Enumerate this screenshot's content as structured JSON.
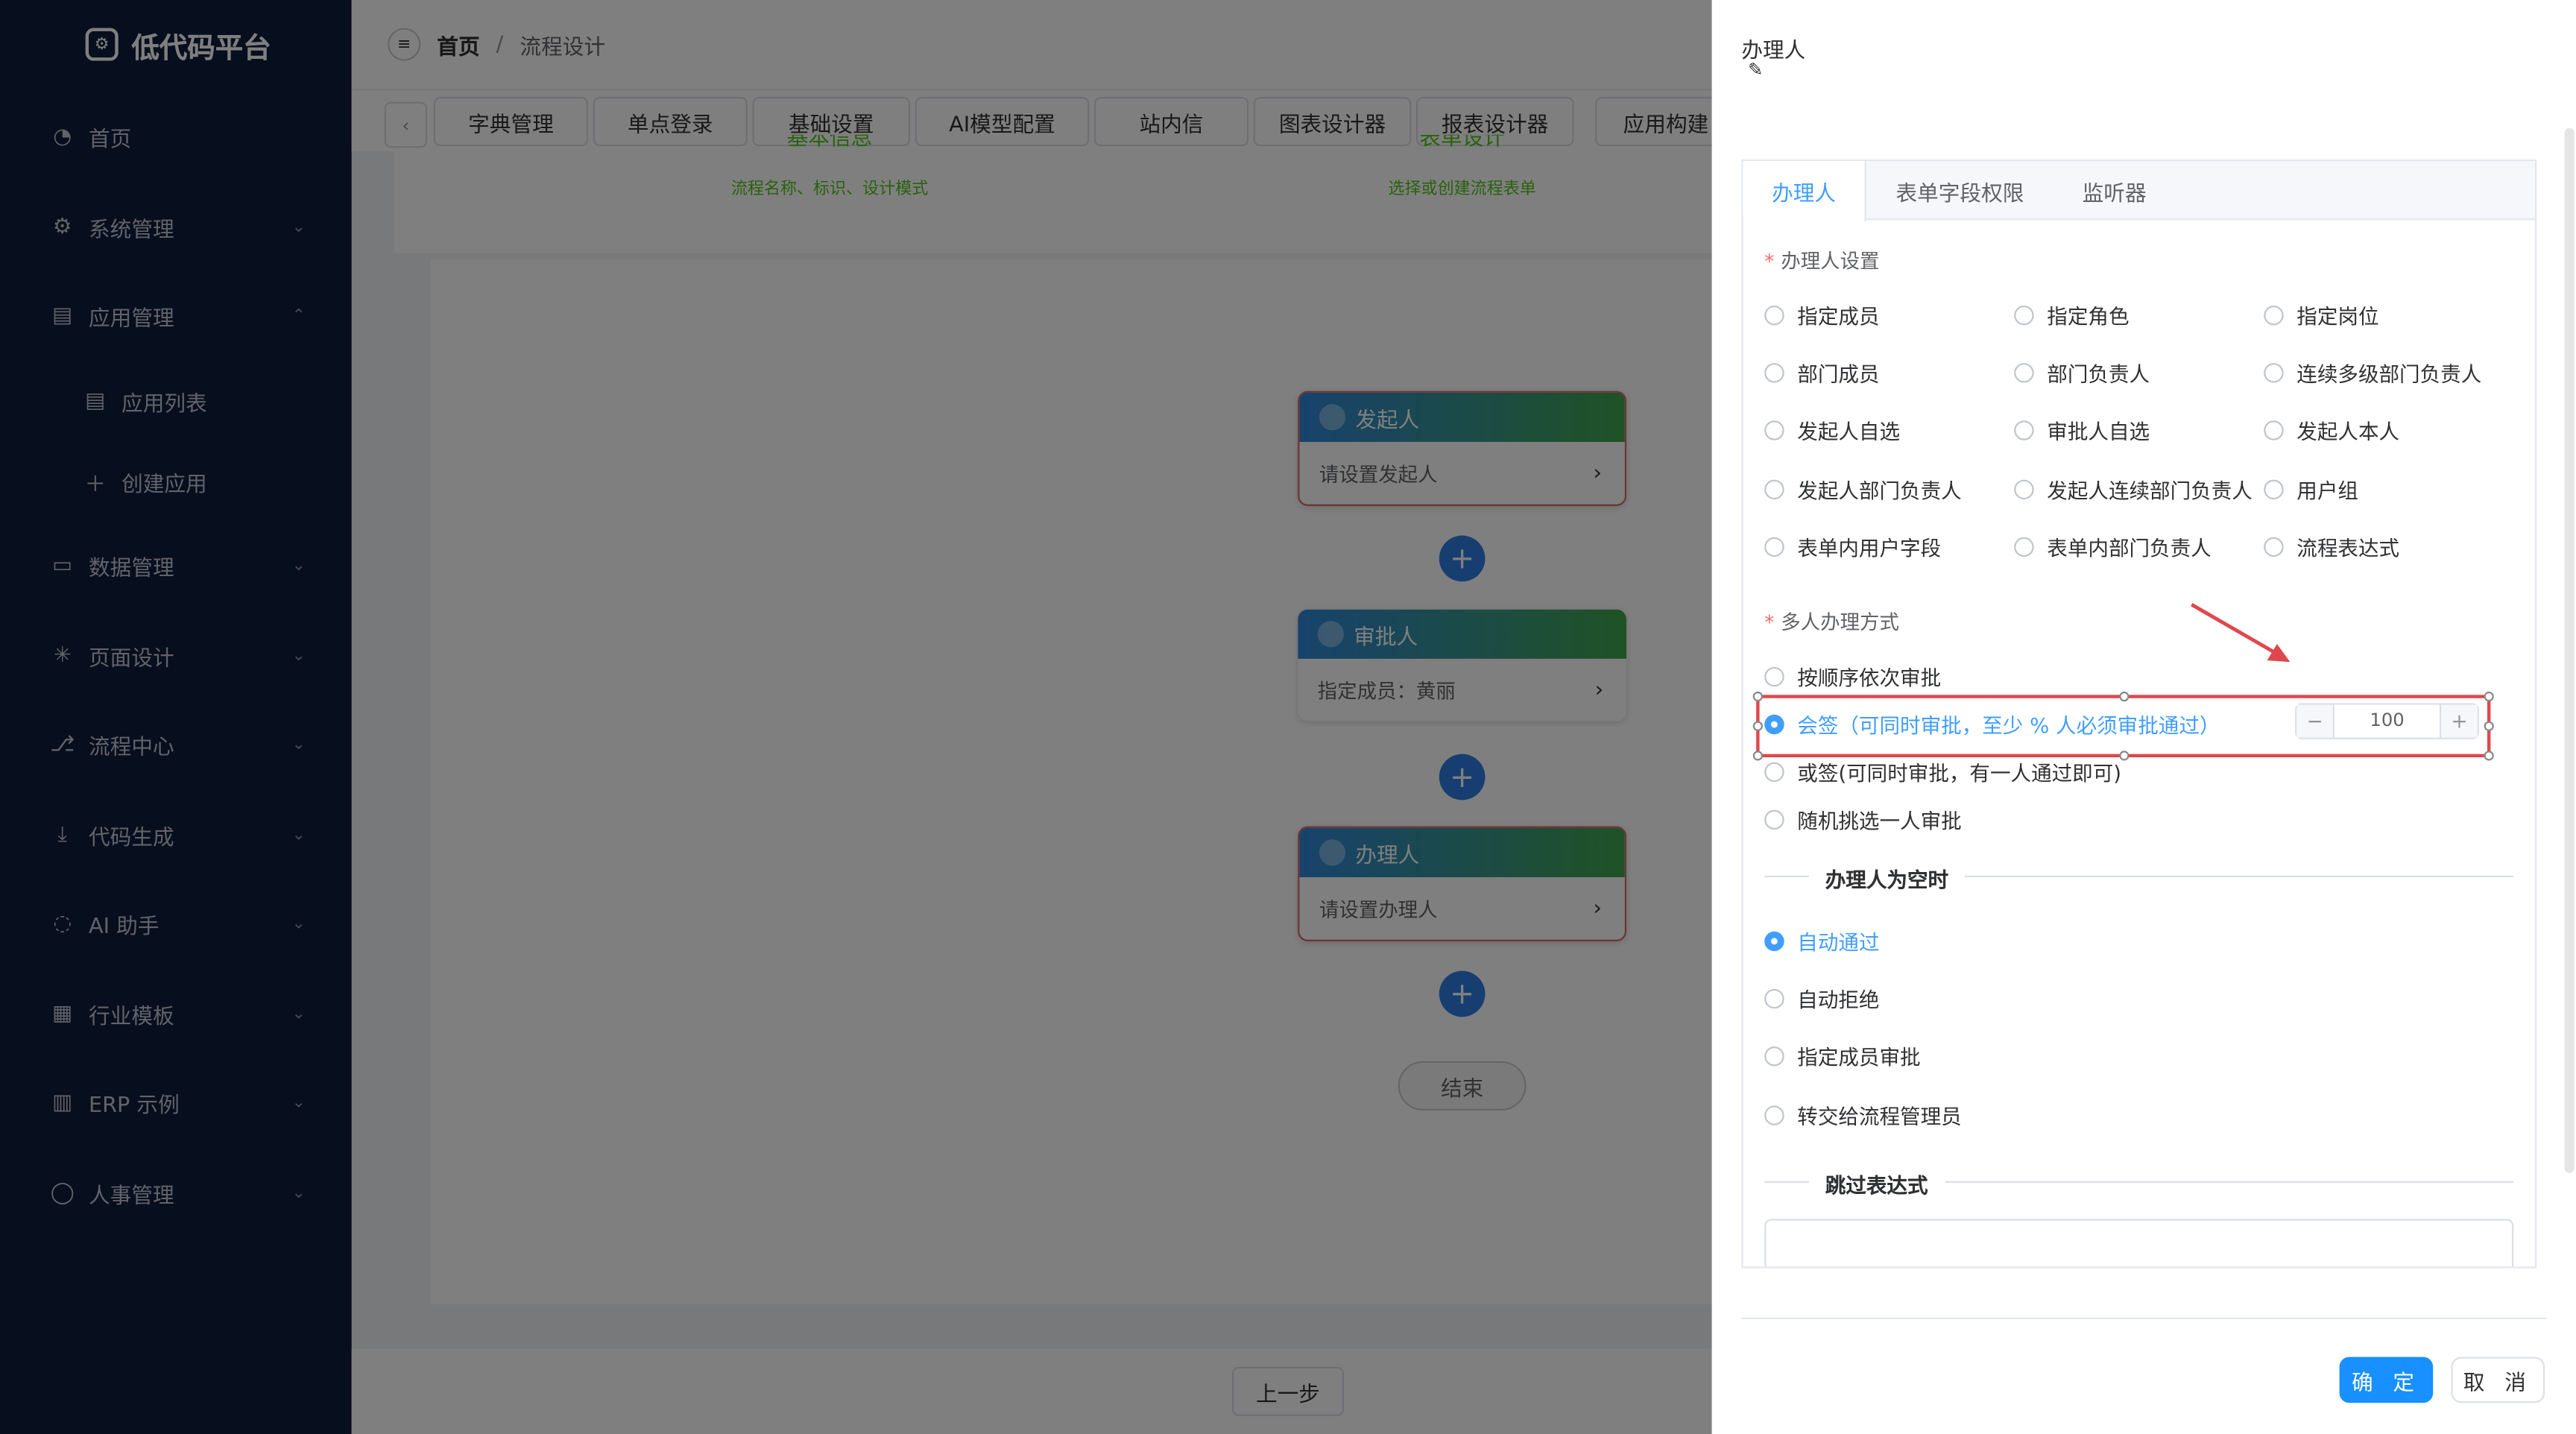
{
  "app": {
    "title": "低代码平台"
  },
  "sidebar": {
    "items": [
      {
        "label": "首页",
        "icon": "dashboard-icon"
      },
      {
        "label": "系统管理",
        "icon": "gear-icon"
      },
      {
        "label": "应用管理",
        "icon": "document-icon"
      },
      {
        "label": "应用列表",
        "icon": "document-icon"
      },
      {
        "label": "创建应用",
        "icon": "plus-icon"
      },
      {
        "label": "数据管理",
        "icon": "chart-board-icon"
      },
      {
        "label": "页面设计",
        "icon": "sparkle-icon"
      },
      {
        "label": "流程中心",
        "icon": "flow-icon"
      },
      {
        "label": "代码生成",
        "icon": "download-icon"
      },
      {
        "label": "AI 助手",
        "icon": "chat-icon"
      },
      {
        "label": "行业模板",
        "icon": "grid-icon"
      },
      {
        "label": "ERP 示例",
        "icon": "building-icon"
      },
      {
        "label": "人事管理",
        "icon": "user-icon"
      }
    ]
  },
  "breadcrumb": {
    "home": "首页",
    "separator": "/",
    "current": "流程设计"
  },
  "tabs": [
    "字典管理",
    "单点登录",
    "基础设置",
    "AI模型配置",
    "站内信",
    "图表设计器",
    "报表设计器",
    "应用构建"
  ],
  "steps": [
    {
      "title": "基本信息",
      "desc": "流程名称、标识、设计模式"
    },
    {
      "title": "表单设计",
      "desc": "选择或创建流程表单"
    }
  ],
  "flow": {
    "nodes": [
      {
        "title": "发起人",
        "body": "请设置发起人"
      },
      {
        "title": "审批人",
        "body": "指定成员：黄丽"
      },
      {
        "title": "办理人",
        "body": "请设置办理人"
      }
    ],
    "end_label": "结束"
  },
  "footer": {
    "prev_label": "上一步"
  },
  "drawer": {
    "title": "办理人",
    "tabs": [
      "办理人",
      "表单字段权限",
      "监听器"
    ],
    "handler_section": {
      "label": "办理人设置",
      "options": [
        "指定成员",
        "指定角色",
        "指定岗位",
        "部门成员",
        "部门负责人",
        "连续多级部门负责人",
        "发起人自选",
        "审批人自选",
        "发起人本人",
        "发起人部门负责人",
        "发起人连续部门负责人",
        "用户组",
        "表单内用户字段",
        "表单内部门负责人",
        "流程表达式"
      ]
    },
    "multi_section": {
      "label": "多人办理方式",
      "options": [
        "按顺序依次审批",
        "会签（可同时审批，至少 % 人必须审批通过）",
        "或签(可同时审批，有一人通过即可)",
        "随机挑选一人审批"
      ],
      "selected": 1,
      "percent_value": "100"
    },
    "empty_section": {
      "label": "办理人为空时",
      "options": [
        "自动通过",
        "自动拒绝",
        "指定成员审批",
        "转交给流程管理员"
      ],
      "selected": 0
    },
    "skip_section": {
      "label": "跳过表达式"
    },
    "ok_label": "确 定",
    "cancel_label": "取 消"
  },
  "colors": {
    "sidebar": "#0f1d3a",
    "primary": "#409eff",
    "highlight": "#e0474c"
  }
}
